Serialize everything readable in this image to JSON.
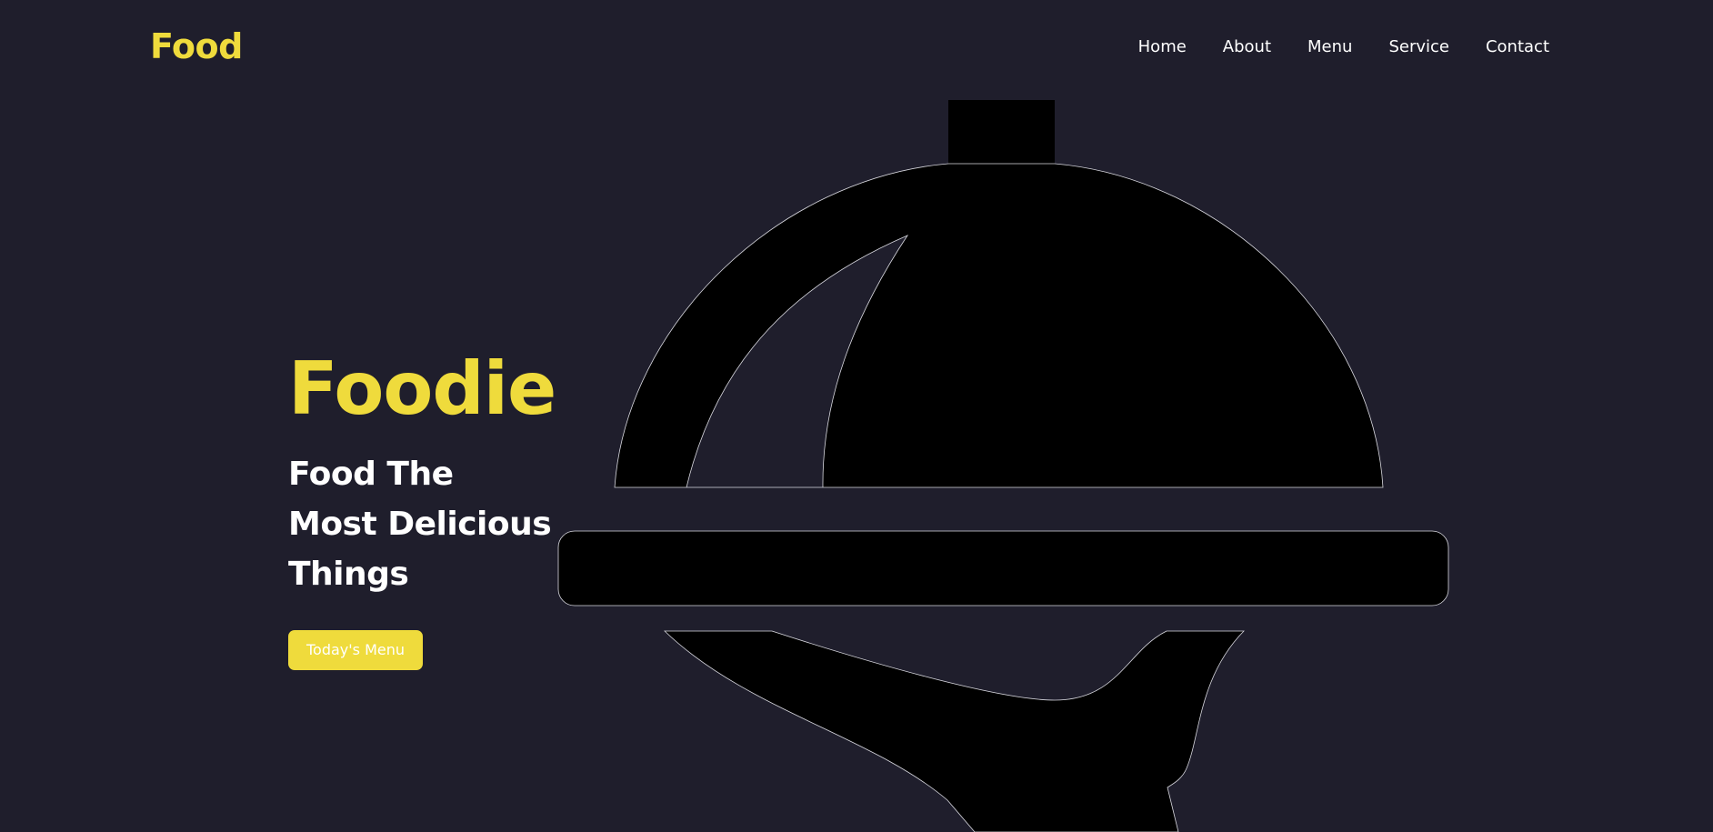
{
  "brand": {
    "logo": "Food"
  },
  "nav": {
    "items": [
      {
        "label": "Home"
      },
      {
        "label": "About"
      },
      {
        "label": "Menu"
      },
      {
        "label": "Service"
      },
      {
        "label": "Contact"
      }
    ]
  },
  "hero": {
    "title": "Foodie",
    "subtitle": "Food The Most Delicious Things",
    "button_label": "Today's Menu",
    "illustration_icon": "serving-cloche-icon"
  },
  "colors": {
    "background": "#1f1e2c",
    "accent": "#efdb3c",
    "text": "#ffffff",
    "illustration": "#000000"
  }
}
